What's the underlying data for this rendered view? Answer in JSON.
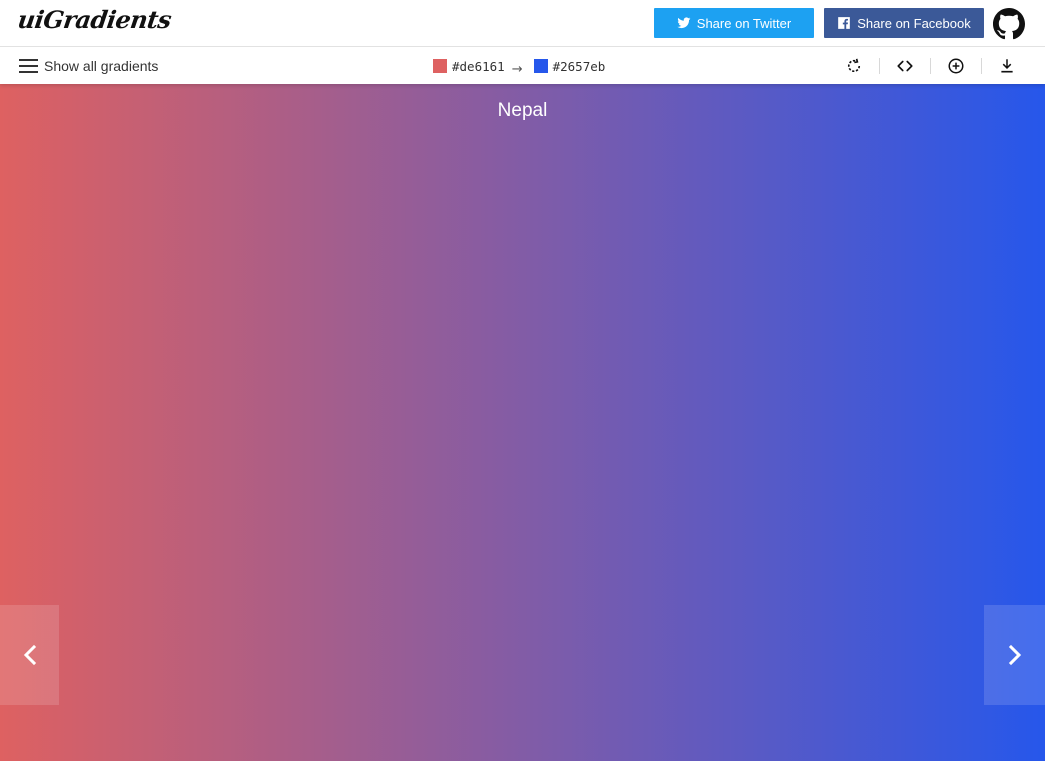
{
  "header": {
    "logo_text": "uiGradients",
    "twitter_label": "Share on Twitter",
    "facebook_label": "Share on Facebook",
    "twitter_color": "#1da1f2",
    "facebook_color": "#3b5998",
    "github_icon": "github-icon"
  },
  "toolbar": {
    "show_all_label": "Show all gradients",
    "color_from": "#de6161",
    "color_to": "#2657eb",
    "arrow_glyph": "→",
    "icons": [
      "rotate-icon",
      "code-icon",
      "add-circle-icon",
      "download-icon"
    ]
  },
  "gradient": {
    "name": "Nepal",
    "from": "#de6161",
    "to": "#2657eb",
    "direction": "to right"
  },
  "navigation": {
    "prev_icon": "chevron-left-icon",
    "next_icon": "chevron-right-icon"
  }
}
